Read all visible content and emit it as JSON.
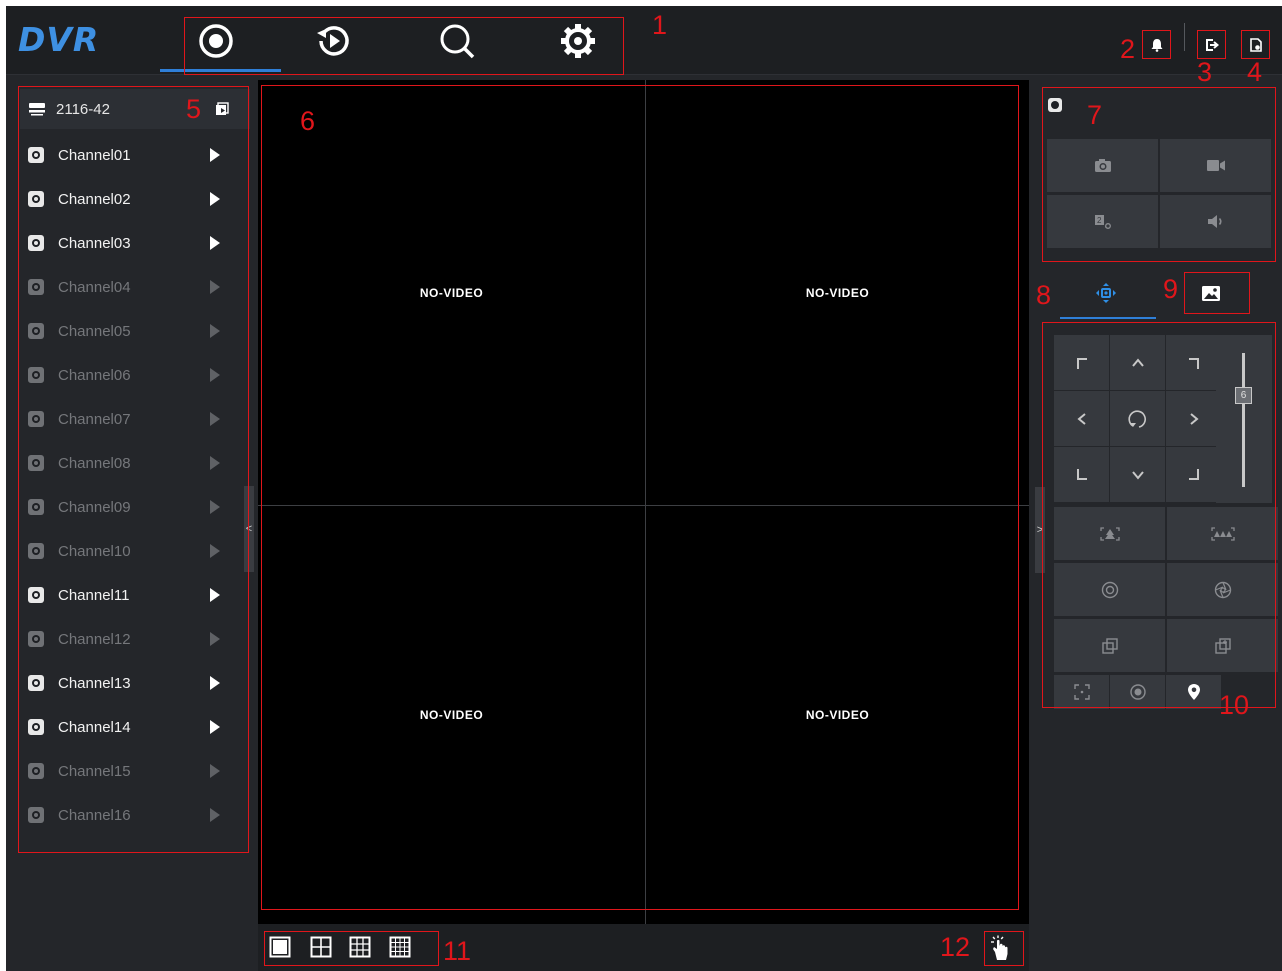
{
  "app": {
    "logo": "DVR"
  },
  "nav": {
    "tabs": [
      {
        "icon": "live-view-icon"
      },
      {
        "icon": "playback-icon"
      },
      {
        "icon": "search-icon"
      },
      {
        "icon": "settings-icon"
      }
    ],
    "active_tab": 0
  },
  "header": {
    "buttons": [
      {
        "icon": "bell-icon"
      },
      {
        "icon": "logout-icon"
      },
      {
        "icon": "help-document-icon"
      }
    ]
  },
  "device": {
    "name": "2116-42"
  },
  "channels": [
    {
      "name": "Channel01",
      "online": true
    },
    {
      "name": "Channel02",
      "online": true
    },
    {
      "name": "Channel03",
      "online": true
    },
    {
      "name": "Channel04",
      "online": false
    },
    {
      "name": "Channel05",
      "online": false
    },
    {
      "name": "Channel06",
      "online": false
    },
    {
      "name": "Channel07",
      "online": false
    },
    {
      "name": "Channel08",
      "online": false
    },
    {
      "name": "Channel09",
      "online": false
    },
    {
      "name": "Channel10",
      "online": false
    },
    {
      "name": "Channel11",
      "online": true
    },
    {
      "name": "Channel12",
      "online": false
    },
    {
      "name": "Channel13",
      "online": true
    },
    {
      "name": "Channel14",
      "online": true
    },
    {
      "name": "Channel15",
      "online": false
    },
    {
      "name": "Channel16",
      "online": false
    }
  ],
  "video": {
    "cells": [
      {
        "status": "NO-VIDEO"
      },
      {
        "status": "NO-VIDEO"
      },
      {
        "status": "NO-VIDEO"
      },
      {
        "status": "NO-VIDEO"
      }
    ]
  },
  "collapse": {
    "left": "<",
    "right": ">"
  },
  "ptz": {
    "speed": "6"
  },
  "annotations": [
    "1",
    "2",
    "3",
    "4",
    "5",
    "6",
    "7",
    "8",
    "9",
    "10",
    "11",
    "12"
  ],
  "colors": {
    "accent": "#2f7fd8",
    "annotation": "#e0161b",
    "background": "#24262a"
  }
}
